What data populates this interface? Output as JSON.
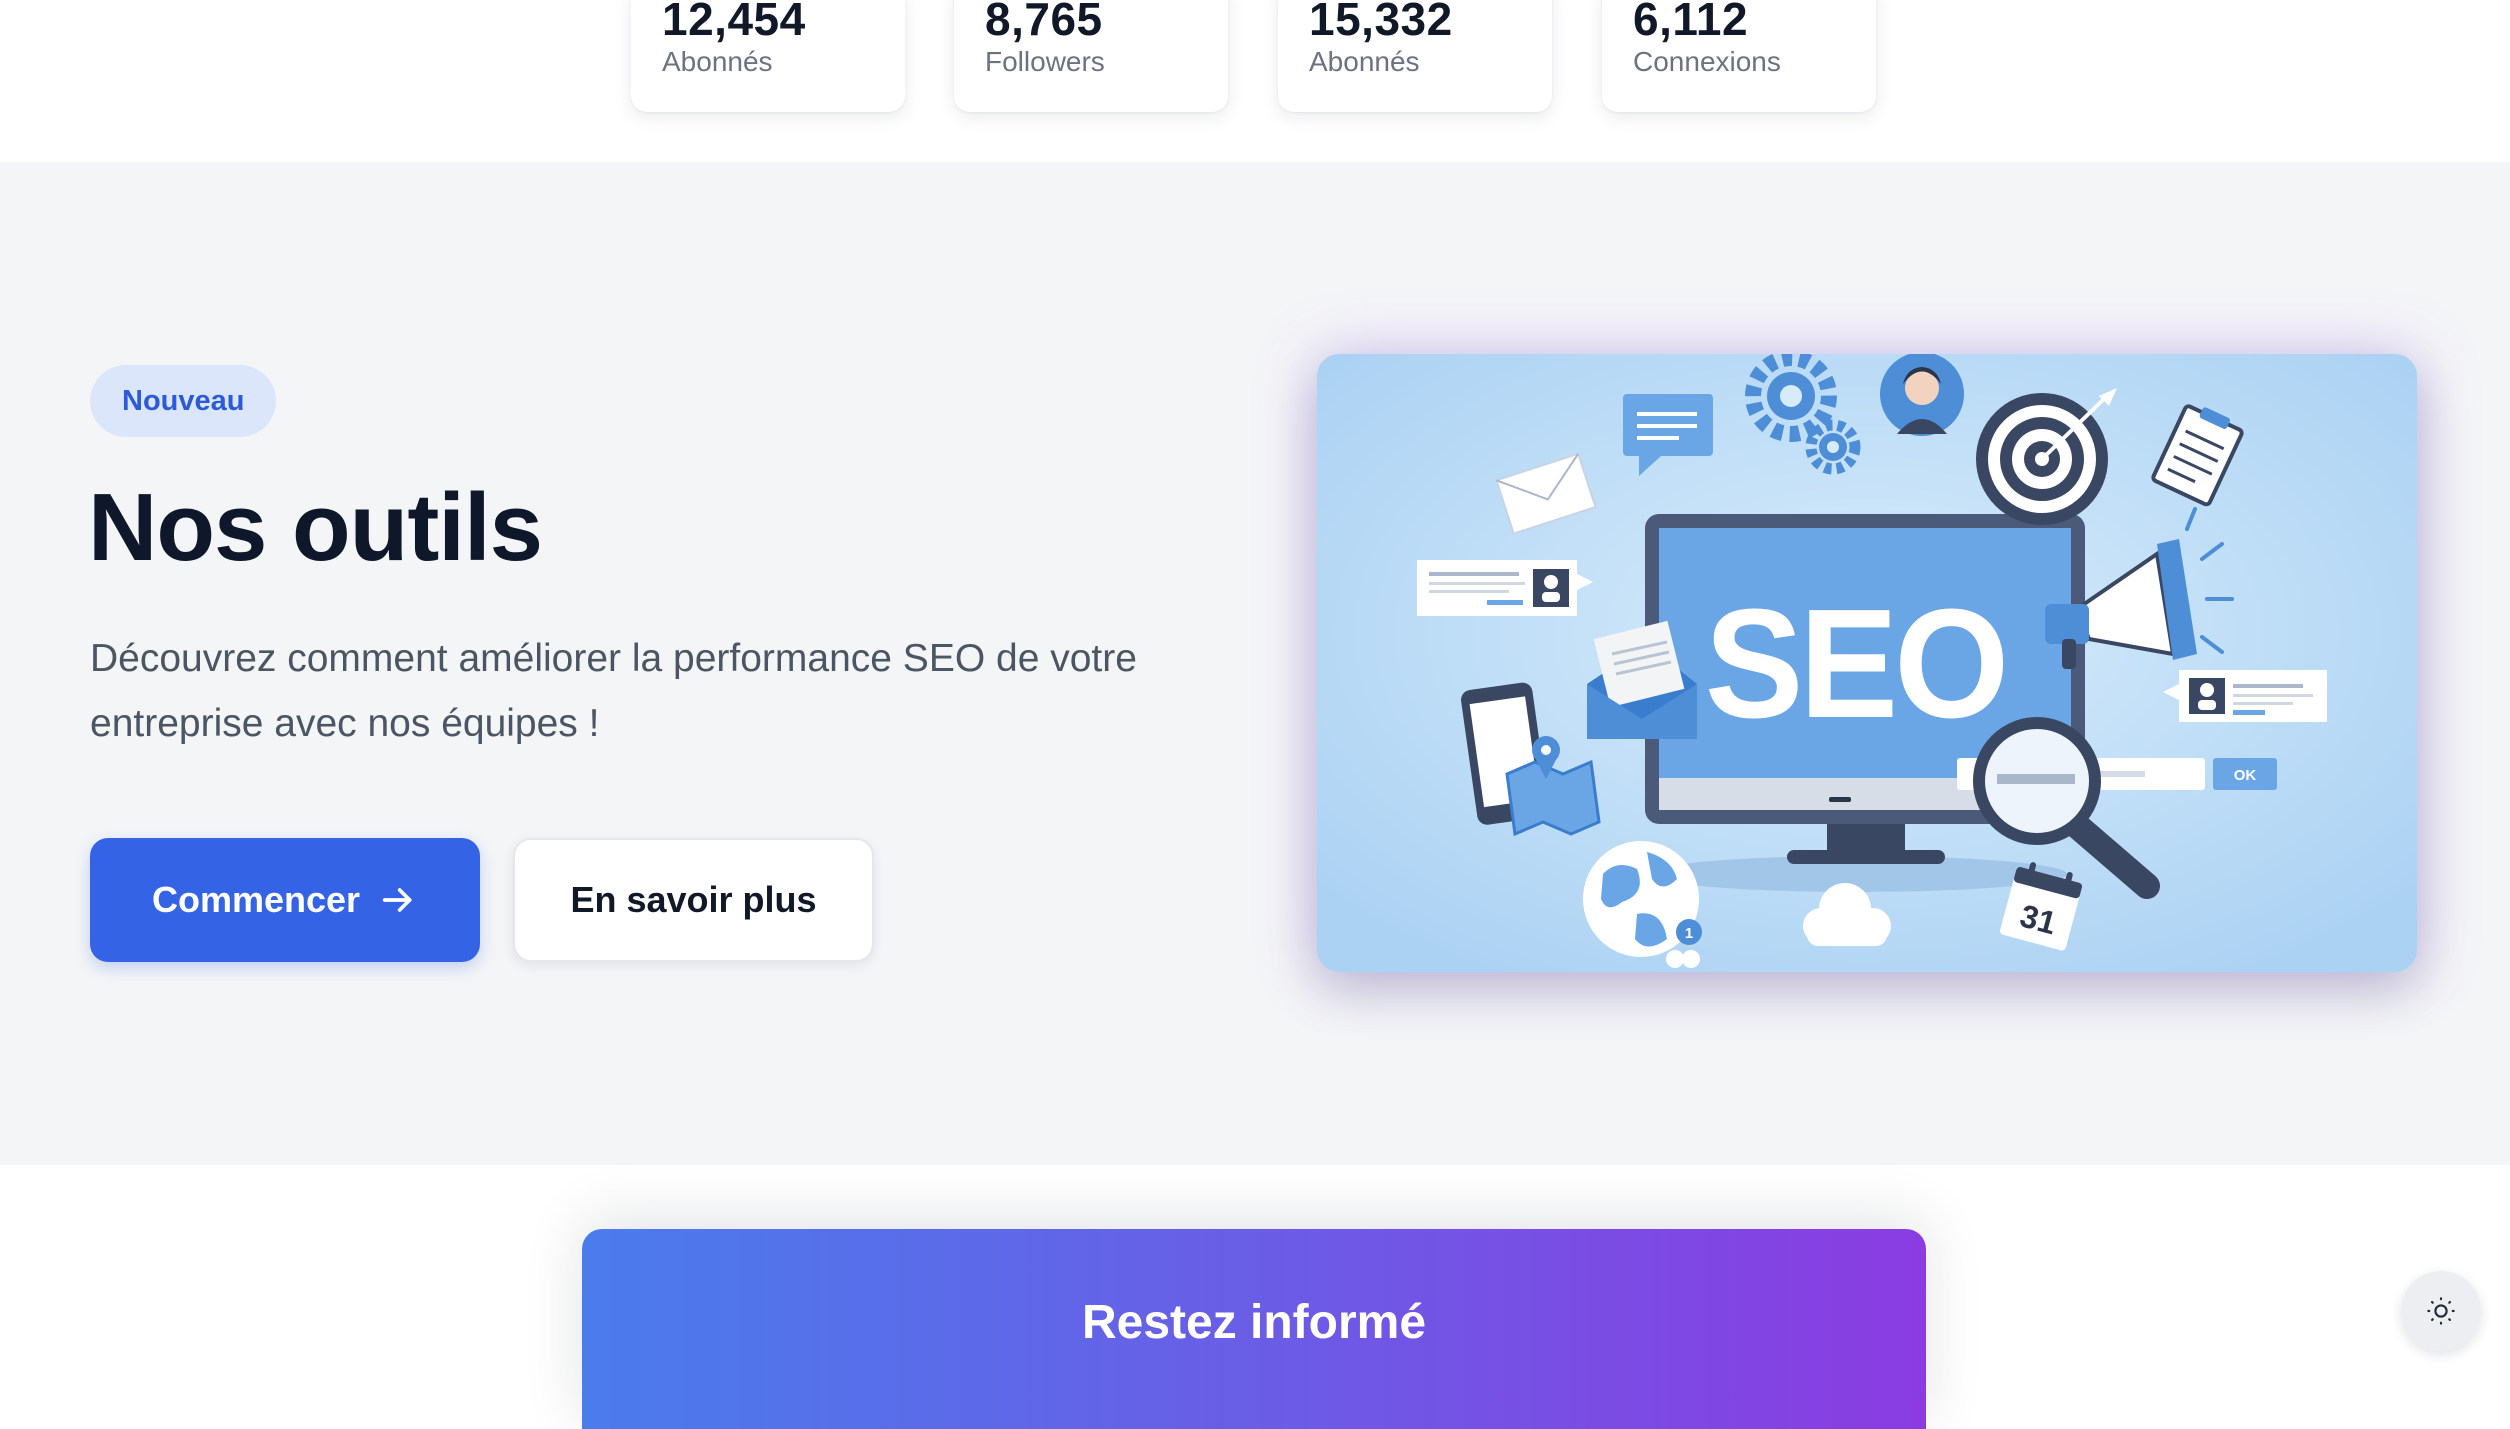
{
  "stats": [
    {
      "value": "12,454",
      "label": "Abonnés"
    },
    {
      "value": "8,765",
      "label": "Followers"
    },
    {
      "value": "15,332",
      "label": "Abonnés"
    },
    {
      "value": "6,112",
      "label": "Connexions"
    }
  ],
  "hero": {
    "badge": "Nouveau",
    "title": "Nos outils",
    "description": "Découvrez comment améliorer la performance SEO de votre entreprise avec nos équipes !",
    "primary_button": "Commencer",
    "primary_button_icon": "arrow-right-icon",
    "secondary_button": "En savoir plus",
    "illustration": {
      "monitor_text": "SEO",
      "search_button_text": "OK",
      "calendar_day": "31",
      "notification_count": "1"
    }
  },
  "newsletter": {
    "title": "Restez informé"
  },
  "theme_toggle": {
    "icon": "sun-icon"
  },
  "colors": {
    "primary": "#3563e5",
    "badge_bg": "#dbe6fb",
    "badge_text": "#2b5bd7",
    "hero_bg": "#f4f5f7",
    "newsletter_gradient_start": "#4a7cec",
    "newsletter_gradient_end": "#8a3ce2"
  }
}
